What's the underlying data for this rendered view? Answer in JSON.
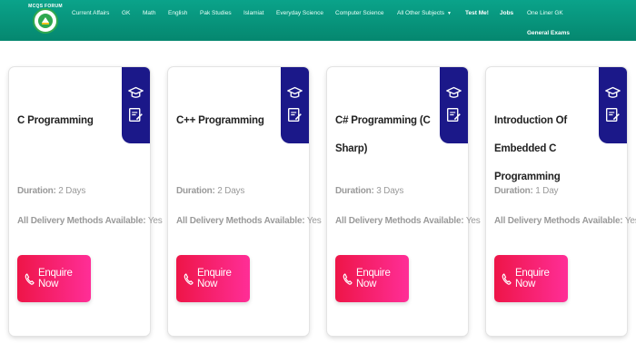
{
  "brand": {
    "logo_text": "MCQS FORUM"
  },
  "nav": {
    "items": [
      "Current Affairs",
      "GK",
      "Math",
      "English",
      "Pak Studies",
      "Islamiat",
      "Everyday Science",
      "Computer Science",
      "All Other Subjects"
    ],
    "highlight_items": [
      "Test Me!",
      "Jobs"
    ],
    "extra_items": [
      "One Liner GK",
      "General Exams"
    ]
  },
  "courses": [
    {
      "title": "C Programming",
      "duration_label": "Duration:",
      "duration": "2 Days",
      "delivery_label": "All Delivery Methods Available:",
      "delivery": "Yes",
      "button": "Enquire Now"
    },
    {
      "title": "C++ Programming",
      "duration_label": "Duration:",
      "duration": "2 Days",
      "delivery_label": "All Delivery Methods Available:",
      "delivery": "Yes",
      "button": "Enquire Now"
    },
    {
      "title": "C# Programming (C Sharp)",
      "duration_label": "Duration:",
      "duration": "3 Days",
      "delivery_label": "All Delivery Methods Available:",
      "delivery": "Yes",
      "button": "Enquire Now"
    },
    {
      "title": "Introduction Of Embedded C Programming",
      "duration_label": "Duration:",
      "duration": "1 Day",
      "delivery_label": "All Delivery Methods Available:",
      "delivery": "Yes",
      "button": "Enquire Now"
    }
  ],
  "colors": {
    "navbar": "#05876f",
    "badge": "#1b1889",
    "button_start": "#ee1548",
    "button_end": "#ff2e97"
  },
  "icons": {
    "badge": "graduation-cap-certificate-icon",
    "button": "phone-icon",
    "dropdown": "caret-down-icon"
  }
}
